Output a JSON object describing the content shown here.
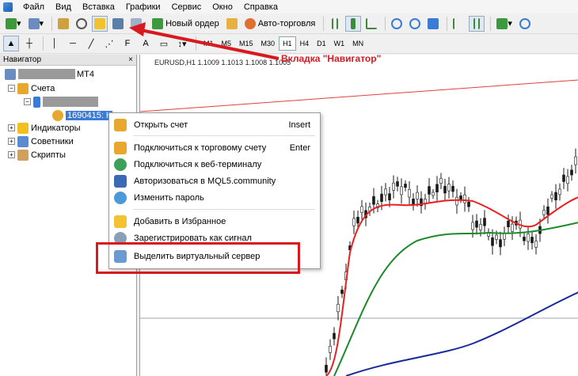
{
  "menubar": {
    "items": [
      "Файл",
      "Вид",
      "Вставка",
      "Графики",
      "Сервис",
      "Окно",
      "Справка"
    ]
  },
  "toolbar": {
    "new_order": "Новый ордер",
    "auto_trading": "Авто-торговля"
  },
  "timeframes": [
    "M1",
    "M5",
    "M15",
    "M30",
    "H1",
    "H4",
    "D1",
    "W1",
    "MN"
  ],
  "active_timeframe": "H1",
  "navigator": {
    "title": "Навигатор",
    "close": "×",
    "root_suffix": "MT4",
    "accounts": "Счета",
    "selected_account": "1690415: К",
    "indicators": "Индикаторы",
    "advisors": "Советники",
    "scripts": "Скрипты"
  },
  "chart": {
    "title": "EURUSD,H1  1.1009 1.1013 1.1008 1.1005"
  },
  "context_menu": {
    "items": [
      {
        "label": "Открыть счет",
        "shortcut": "Insert",
        "icon": "open-account-icon"
      },
      {
        "label": "Подключиться к торговому счету",
        "shortcut": "Enter",
        "icon": "connect-account-icon"
      },
      {
        "label": "Подключиться к веб-терминалу",
        "shortcut": "",
        "icon": "web-terminal-icon"
      },
      {
        "label": "Авторизоваться в MQL5.community",
        "shortcut": "",
        "icon": "mql5-icon"
      },
      {
        "label": "Изменить пароль",
        "shortcut": "",
        "icon": "change-password-icon"
      },
      {
        "label": "Добавить в Избранное",
        "shortcut": "",
        "icon": "favorites-icon"
      },
      {
        "label": "Зарегистрировать как сигнал",
        "shortcut": "",
        "icon": "signal-icon"
      },
      {
        "label": "Выделить виртуальный сервер",
        "shortcut": "",
        "icon": "virtual-server-icon"
      }
    ]
  },
  "annotation": {
    "callout": "Вкладка \"Навигатор\"",
    "color": "#d8191f"
  }
}
